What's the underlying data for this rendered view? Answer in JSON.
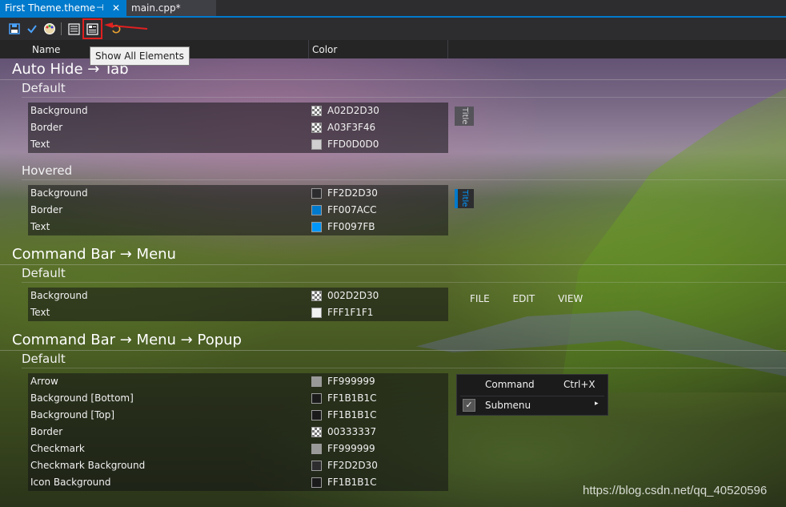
{
  "tabs": [
    {
      "label": "First Theme.theme",
      "pin": "⊣",
      "close": "✕"
    },
    {
      "label": "main.cpp*"
    }
  ],
  "toolbar": {
    "icons": [
      "save-icon",
      "apply-check-icon",
      "palette-icon",
      "show-list-icon",
      "show-all-elements-icon",
      "undo-icon"
    ],
    "tooltip": "Show All Elements"
  },
  "columns": {
    "name": "Name",
    "color": "Color"
  },
  "sections": [
    {
      "title": "Auto Hide → Tab",
      "groups": [
        {
          "name": "Default",
          "rows": [
            {
              "name": "Background",
              "value": "A02D2D30",
              "swatch": "checker"
            },
            {
              "name": "Border",
              "value": "A03F3F46",
              "swatch": "checker"
            },
            {
              "name": "Text",
              "value": "FFD0D0D0",
              "swatch": "#d0d0d0"
            }
          ]
        },
        {
          "name": "Hovered",
          "rows": [
            {
              "name": "Background",
              "value": "FF2D2D30",
              "swatch": "#2d2d30"
            },
            {
              "name": "Border",
              "value": "FF007ACC",
              "swatch": "#007acc"
            },
            {
              "name": "Text",
              "value": "FF0097FB",
              "swatch": "#0097fb"
            }
          ]
        }
      ]
    },
    {
      "title": "Command Bar → Menu",
      "groups": [
        {
          "name": "Default",
          "rows": [
            {
              "name": "Background",
              "value": "002D2D30",
              "swatch": "checker"
            },
            {
              "name": "Text",
              "value": "FFF1F1F1",
              "swatch": "#f1f1f1"
            }
          ]
        }
      ]
    },
    {
      "title": "Command Bar → Menu → Popup",
      "groups": [
        {
          "name": "Default",
          "rows": [
            {
              "name": "Arrow",
              "value": "FF999999",
              "swatch": "#999999"
            },
            {
              "name": "Background [Bottom]",
              "value": "FF1B1B1C",
              "swatch": "#1b1b1c"
            },
            {
              "name": "Background [Top]",
              "value": "FF1B1B1C",
              "swatch": "#1b1b1c"
            },
            {
              "name": "Border",
              "value": "00333337",
              "swatch": "checker"
            },
            {
              "name": "Checkmark",
              "value": "FF999999",
              "swatch": "#999999"
            },
            {
              "name": "Checkmark Background",
              "value": "FF2D2D30",
              "swatch": "#2d2d30"
            },
            {
              "name": "Icon Background",
              "value": "FF1B1B1C",
              "swatch": "#1b1b1c"
            }
          ]
        }
      ]
    }
  ],
  "preview": {
    "title_label": "Title",
    "menu": [
      "FILE",
      "EDIT",
      "VIEW"
    ],
    "popup": {
      "command": "Command",
      "shortcut": "Ctrl+X",
      "submenu": "Submenu",
      "check": "✓",
      "arrow": "▸"
    }
  },
  "watermark": "https://blog.csdn.net/qq_40520596",
  "colors": {
    "accent": "#007acc",
    "chrome": "#2d2d30",
    "highlight": "#e02020"
  }
}
